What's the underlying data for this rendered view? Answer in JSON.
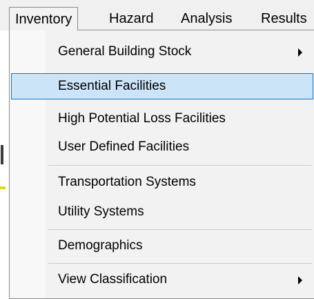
{
  "menubar": {
    "items": [
      {
        "label": "Inventory",
        "active": true
      },
      {
        "label": "Hazard"
      },
      {
        "label": "Analysis"
      },
      {
        "label": "Results"
      }
    ]
  },
  "inventory_menu": {
    "items": [
      {
        "label": "General Building Stock",
        "has_submenu": true,
        "submenu_icon": "triangle-right"
      },
      {
        "label": "Essential Facilities",
        "highlighted": true
      },
      {
        "label": "High Potential Loss Facilities"
      },
      {
        "label": "User Defined Facilities"
      },
      {
        "label": "Transportation Systems"
      },
      {
        "label": "Utility Systems"
      },
      {
        "label": "Demographics"
      },
      {
        "label": "View Classification",
        "has_submenu": true,
        "submenu_icon": "triangle-right"
      }
    ]
  },
  "colors": {
    "highlight_fill": "#cce4f7",
    "highlight_border": "#0078d4",
    "menu_background": "#f2f2f2"
  }
}
